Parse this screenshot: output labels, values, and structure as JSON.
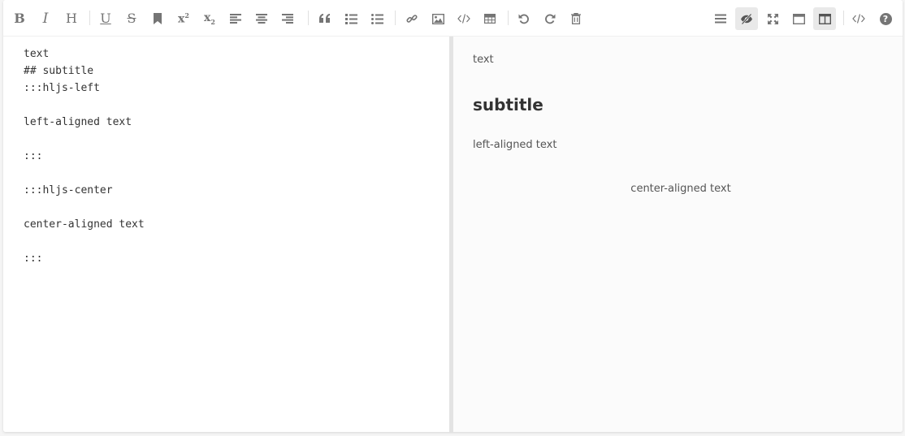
{
  "toolbar": {
    "bold_label": "B",
    "italic_label": "I",
    "header_label": "H",
    "underline_label": "U",
    "strike_label": "S",
    "superscript_label": "x",
    "superscript_mark": "2",
    "subscript_label": "x",
    "subscript_mark": "2",
    "help_label": "?"
  },
  "editor": {
    "source_text": "text\n## subtitle\n:::hljs-left\n\nleft-aligned text\n\n:::\n\n:::hljs-center\n\ncenter-aligned text\n\n:::"
  },
  "preview": {
    "paragraph": "text",
    "heading": "subtitle",
    "left_text": "left-aligned text",
    "center_text": "center-aligned text"
  },
  "colors": {
    "icon": "#757575",
    "active_bg": "#e9e9e9",
    "divider": "#e3e3e3",
    "preview_bg": "#fbfbfb"
  }
}
